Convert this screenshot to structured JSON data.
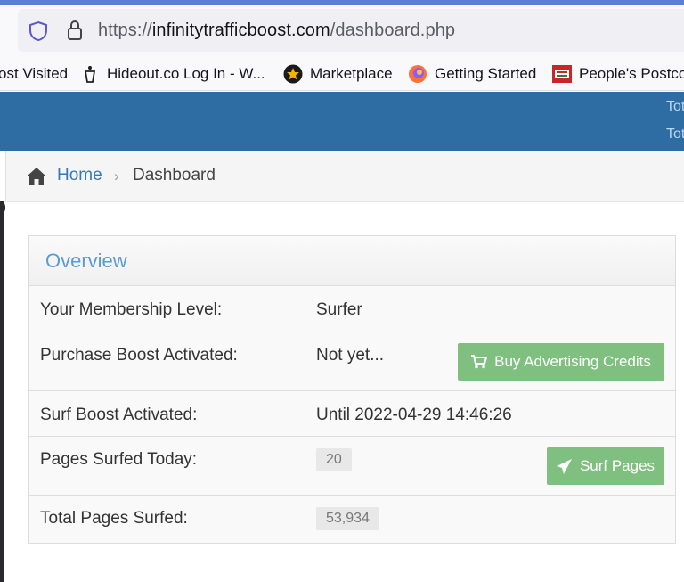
{
  "browser": {
    "url_scheme": "https://",
    "url_host": "infinitytrafficboost.com",
    "url_path": "/dashboard.php",
    "bookmarks": [
      {
        "label": "ost Visited",
        "icon": "none"
      },
      {
        "label": "Hideout.co Log In - W...",
        "icon": "hideout-icon"
      },
      {
        "label": "Marketplace",
        "icon": "marketplace-star-icon"
      },
      {
        "label": "Getting Started",
        "icon": "firefox-icon"
      },
      {
        "label": "People's Postco",
        "icon": "postcode-icon"
      }
    ]
  },
  "header": {
    "stat1": "Tot",
    "stat2": "Tot"
  },
  "breadcrumb": {
    "home": "Home",
    "separator": "›",
    "current": "Dashboard"
  },
  "panel": {
    "title": "Overview",
    "rows": [
      {
        "label": "Your Membership Level:",
        "value": "Surfer"
      },
      {
        "label": "Purchase Boost Activated:",
        "value": "Not yet...",
        "button": "Buy Advertising Credits"
      },
      {
        "label": "Surf Boost Activated:",
        "value": "Until 2022-04-29 14:46:26"
      },
      {
        "label": "Pages Surfed Today:",
        "value": "20",
        "button": "Surf Pages"
      },
      {
        "label": "Total Pages Surfed:",
        "value": "53,934"
      }
    ]
  },
  "colors": {
    "header_blue": "#2e6da4",
    "link_blue": "#337ab7",
    "button_green": "#7fbf7f"
  }
}
